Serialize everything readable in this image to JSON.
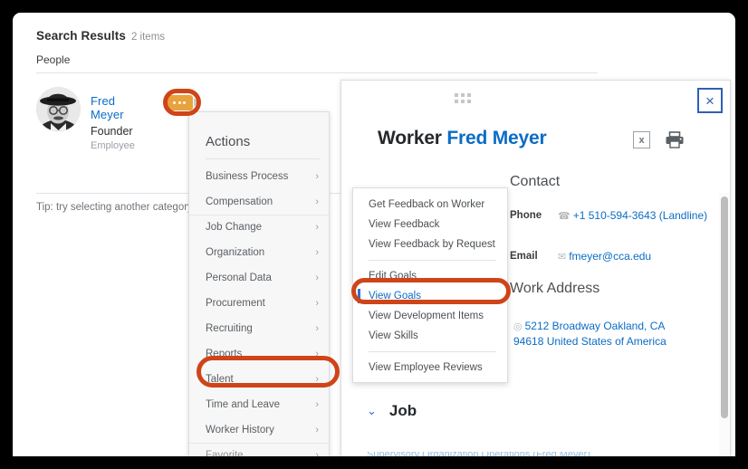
{
  "search_results": {
    "title": "Search Results",
    "count_label": "2 items",
    "category_label": "People",
    "tip": "Tip: try selecting another category",
    "person": {
      "name": "Fred Meyer",
      "job_title": "Founder",
      "worker_type": "Employee",
      "related_actions_icon": "related-actions-chip-icon",
      "avatar_icon": "person-photo-avatar"
    }
  },
  "actions_menu": {
    "title": "Actions",
    "items": [
      {
        "label": "Business Process",
        "chevron": "›"
      },
      {
        "label": "Compensation",
        "chevron": "›"
      },
      {
        "label": "Job Change",
        "chevron": "›"
      },
      {
        "label": "Organization",
        "chevron": "›"
      },
      {
        "label": "Personal Data",
        "chevron": "›"
      },
      {
        "label": "Procurement",
        "chevron": "›"
      },
      {
        "label": "Recruiting",
        "chevron": "›"
      },
      {
        "label": "Reports",
        "chevron": "›"
      },
      {
        "label": "Talent",
        "chevron": "›"
      },
      {
        "label": "Time and Leave",
        "chevron": "›"
      },
      {
        "label": "Worker History",
        "chevron": "›"
      },
      {
        "label": "Favorite",
        "chevron": "›"
      }
    ]
  },
  "talent_submenu": {
    "items": [
      {
        "label": "Get Feedback on Worker"
      },
      {
        "label": "View Feedback"
      },
      {
        "label": "View Feedback by Request"
      },
      {
        "label": "Edit Goals"
      },
      {
        "label": "View Goals"
      },
      {
        "label": "View Development Items"
      },
      {
        "label": "View Skills"
      },
      {
        "label": "View Employee Reviews"
      }
    ],
    "selected": "View Goals"
  },
  "worker_panel": {
    "drag_handle_icon": "drag-handle-dots-icon",
    "close_icon": "×",
    "title_prefix": "Worker",
    "title_name": "Fred Meyer",
    "export_excel_icon": "x",
    "print_icon": "printer-icon",
    "contact": {
      "heading": "Contact",
      "phone_label": "Phone",
      "phone_value": "+1 510-594-3643 (Landline)",
      "phone_icon": "☎",
      "email_label": "Email",
      "email_value": "fmeyer@cca.edu",
      "email_icon": "✉"
    },
    "work_address": {
      "heading": "Work Address",
      "value": "5212 Broadway Oakland, CA 94618 United States of America",
      "location_icon": "◎"
    },
    "job": {
      "heading": "Job",
      "chevron": "⌄",
      "cut_off_text": "Supervisory Organization  Operations (Fred Meyer)"
    }
  },
  "annotations": {
    "highlight_color": "#cf4418",
    "rings": [
      "related-actions-chip",
      "talent-menu-item",
      "view-goals-item"
    ]
  }
}
